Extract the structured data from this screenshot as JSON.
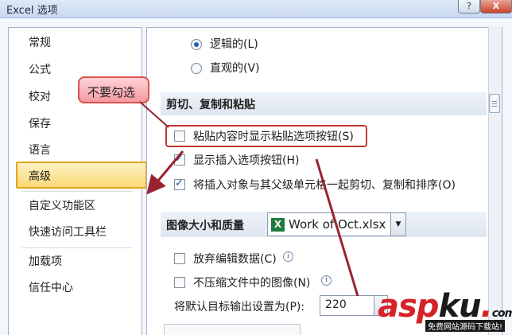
{
  "window": {
    "title": "Excel 选项",
    "help_label": "?",
    "close_label": "X"
  },
  "sidebar": {
    "items": [
      {
        "label": "常规"
      },
      {
        "label": "公式"
      },
      {
        "label": "校对"
      },
      {
        "label": "保存"
      },
      {
        "label": "语言"
      },
      {
        "label": "高级",
        "selected": true
      },
      {
        "label": "自定义功能区"
      },
      {
        "label": "快速访问工具栏"
      },
      {
        "label": "加载项"
      },
      {
        "label": "信任中心"
      }
    ]
  },
  "main": {
    "radio_logical": {
      "label": "逻辑的(L)",
      "checked": true
    },
    "radio_visual": {
      "label": "直观的(V)",
      "checked": false
    },
    "section_clipboard": {
      "title": "剪切、复制和粘贴"
    },
    "chk_paste_options": {
      "label": "粘贴内容时显示粘贴选项按钮(S)",
      "checked": false
    },
    "chk_insert_options": {
      "label": "显示插入选项按钮(H)",
      "checked": true
    },
    "chk_cut_copy_sort": {
      "label": "将插入对象与其父级单元格一起剪切、复制和排序(O)",
      "checked": true
    },
    "section_image": {
      "title": "图像大小和质量",
      "workbook_value": "Work of Oct.xlsx",
      "workbook_icon": "excel-file-icon"
    },
    "chk_discard_edit": {
      "label": "放弃编辑数据(C)",
      "checked": false
    },
    "chk_no_compress": {
      "label": "不压缩文件中的图像(N)",
      "checked": false
    },
    "default_target": {
      "label": "将默认目标输出设置为(P):",
      "value": "220"
    },
    "info_glyph": "i"
  },
  "annotation": {
    "callout_text": "不要勾选",
    "highlight_color": "#c0392b"
  },
  "watermark": {
    "asp": "asp",
    "ku": "ku",
    "dot": ".",
    "com": "com",
    "subtitle": "免费网站源码下载站!"
  },
  "colors": {
    "selected_fill": "#fbd976",
    "selected_border": "#e6a51e",
    "accent_red": "#d7222a",
    "arrow_red": "#9b2230"
  }
}
